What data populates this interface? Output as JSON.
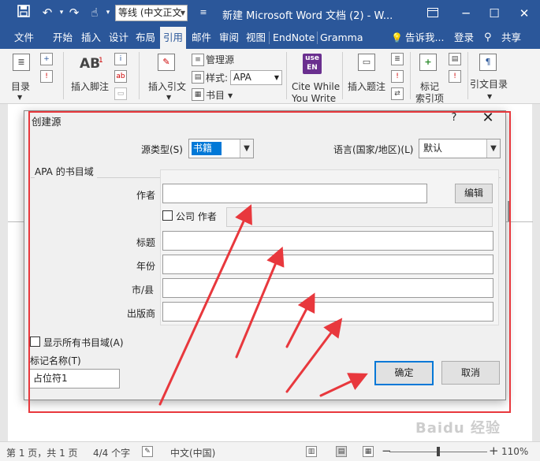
{
  "titlebar": {
    "save_icon": "save-icon",
    "undo_icon": "undo-icon",
    "redo_icon": "redo-icon",
    "touch_icon": "touch-mode-icon",
    "font_value": "等线 (中文正文",
    "doc_title": "新建 Microsoft Word 文档 (2) - W...",
    "minimize": "─",
    "restore": "☐",
    "close": "✕"
  },
  "tabs": {
    "file": "文件",
    "home": "开始",
    "insert": "插入",
    "design": "设计",
    "layout": "布局",
    "references": "引用",
    "mailings": "邮件",
    "review": "审阅",
    "view": "视图",
    "endnote": "EndNote",
    "grammarly": "Gramma",
    "tell_me": "告诉我...",
    "login": "登录",
    "share": "共享"
  },
  "ribbon": {
    "toc": "目录",
    "insert_footnote": "插入脚注",
    "footnote_ab": "AB",
    "insert_citation": "插入引文",
    "manage_sources": "管理源",
    "style_label": "样式:",
    "style_value": "APA",
    "bibliography": "书目",
    "cite_while_line1": "Cite While",
    "cite_while_line2": "You Write",
    "endnote_badge_top": "use",
    "endnote_badge": "EN",
    "insert_caption": "插入题注",
    "mark_entry_line1": "标记",
    "mark_entry_line2": "索引项",
    "table_of_authorities": "引文目录"
  },
  "dialog": {
    "title": "创建源",
    "help": "?",
    "close": "✕",
    "source_type_label": "源类型(S)",
    "source_type_value": "书籍",
    "language_label": "语言(国家/地区)(L)",
    "language_value": "默认",
    "fieldset_caption": "APA 的书目域",
    "author_label": "作者",
    "edit_button": "编辑",
    "corporate_label": "公司 作者",
    "title_label": "标题",
    "year_label": "年份",
    "city_label": "市/县",
    "publisher_label": "出版商",
    "show_all_label": "显示所有书目域(A)",
    "tag_name_label": "标记名称(T)",
    "tag_name_value": "占位符1",
    "ok_button": "确定",
    "cancel_button": "取消"
  },
  "statusbar": {
    "page": "第 1 页，共 1 页",
    "words": "4/4 个字",
    "language": "中文(中国)",
    "zoom_minus": "−",
    "zoom_plus": "+",
    "zoom": "110%"
  },
  "watermark": "Baidu 经验",
  "colors": {
    "word_blue": "#2b579a",
    "annotation_red": "#e8383d",
    "selection_blue": "#0078d7"
  }
}
